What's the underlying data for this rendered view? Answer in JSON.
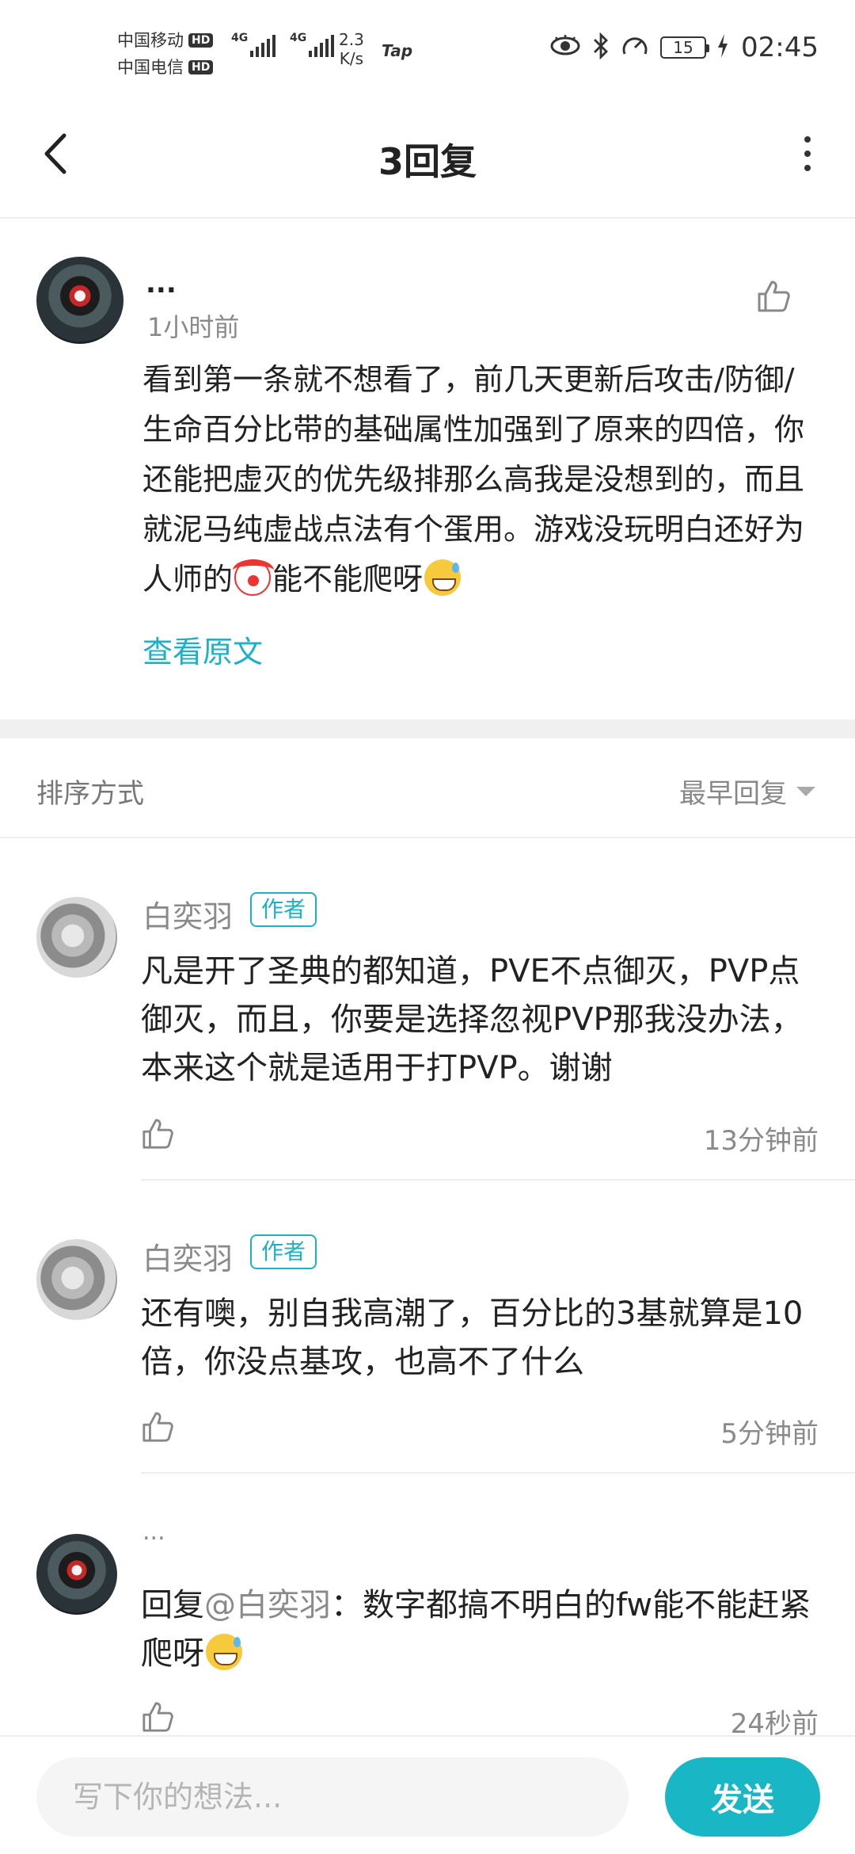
{
  "status_bar": {
    "carrier1": "中国移动",
    "carrier2": "中国电信",
    "hd": "HD",
    "net1": "4G",
    "net2": "4G",
    "speed_value": "2.3",
    "speed_unit": "K/s",
    "tap": "Tap",
    "battery": "15",
    "time": "02:45",
    "icons": [
      "eye-icon",
      "bluetooth-icon",
      "speedometer-icon",
      "battery-icon",
      "charging-icon"
    ]
  },
  "header": {
    "title": "3回复",
    "back_icon": "chevron-left-icon",
    "more_icon": "more-vertical-icon"
  },
  "original": {
    "author": "...",
    "time": "1小时前",
    "text_before_emoji": "看到第一条就不想看了，前几天更新后攻击/防御/生命百分比带的基础属性加强到了原来的四倍，你还能把虚灭的优先级排那么高我是没想到的，而且就泥马纯虚战点法有个蛋用。游戏没玩明白还好为人师的",
    "text_after_emoji": "能不能爬呀",
    "view_original": "查看原文"
  },
  "sort": {
    "label": "排序方式",
    "value": "最早回复"
  },
  "replies": [
    {
      "author": "白奕羽",
      "badge": "作者",
      "text": "凡是开了圣典的都知道，PVE不点御灭，PVP点御灭，而且，你要是选择忽视PVP那我没办法，本来这个就是适用于打PVP。谢谢",
      "time": "13分钟前"
    },
    {
      "author": "白奕羽",
      "badge": "作者",
      "text": "还有噢，别自我高潮了，百分比的3基就算是10倍，你没点基攻，也高不了什么",
      "time": "5分钟前"
    },
    {
      "author": "...",
      "reply_prefix": "回复",
      "mention": "@白奕羽",
      "text": "：数字都搞不明白的fw能不能赶紧爬呀",
      "time": "24秒前"
    }
  ],
  "composer": {
    "placeholder": "写下你的想法...",
    "send": "发送"
  },
  "colors": {
    "accent": "#1eb0c4",
    "send_button": "#19b6c5",
    "muted_text": "#8a8a8a",
    "separator": "#f0f0f0"
  }
}
